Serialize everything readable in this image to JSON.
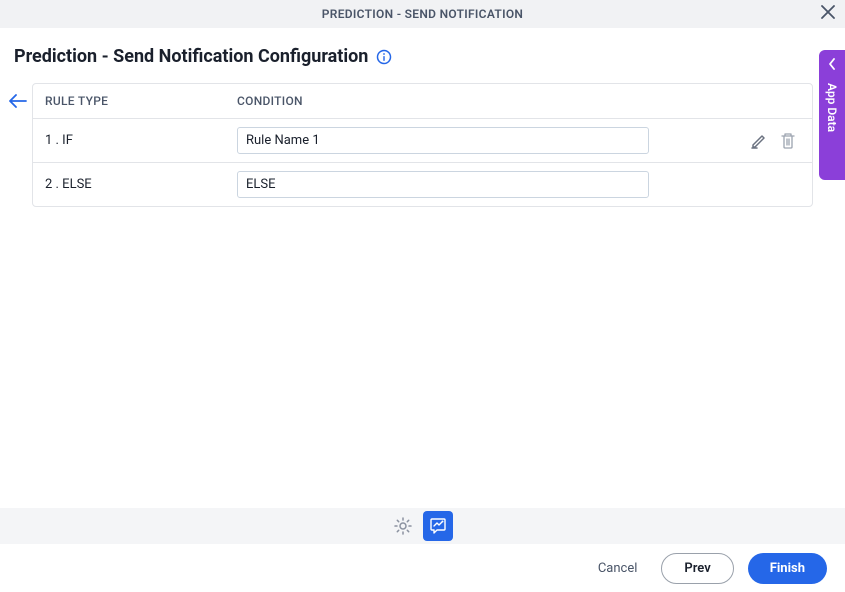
{
  "top": {
    "title": "PREDICTION - SEND NOTIFICATION"
  },
  "page": {
    "title": "Prediction - Send Notification Configuration"
  },
  "table": {
    "headers": {
      "rule_type": "RULE TYPE",
      "condition": "CONDITION"
    },
    "rows": [
      {
        "rule": "1 . IF",
        "condition": "Rule Name 1",
        "show_actions": true
      },
      {
        "rule": "2 . ELSE",
        "condition": "ELSE",
        "show_actions": false
      }
    ]
  },
  "side": {
    "label": "App Data"
  },
  "footer": {
    "cancel": "Cancel",
    "prev": "Prev",
    "finish": "Finish"
  }
}
